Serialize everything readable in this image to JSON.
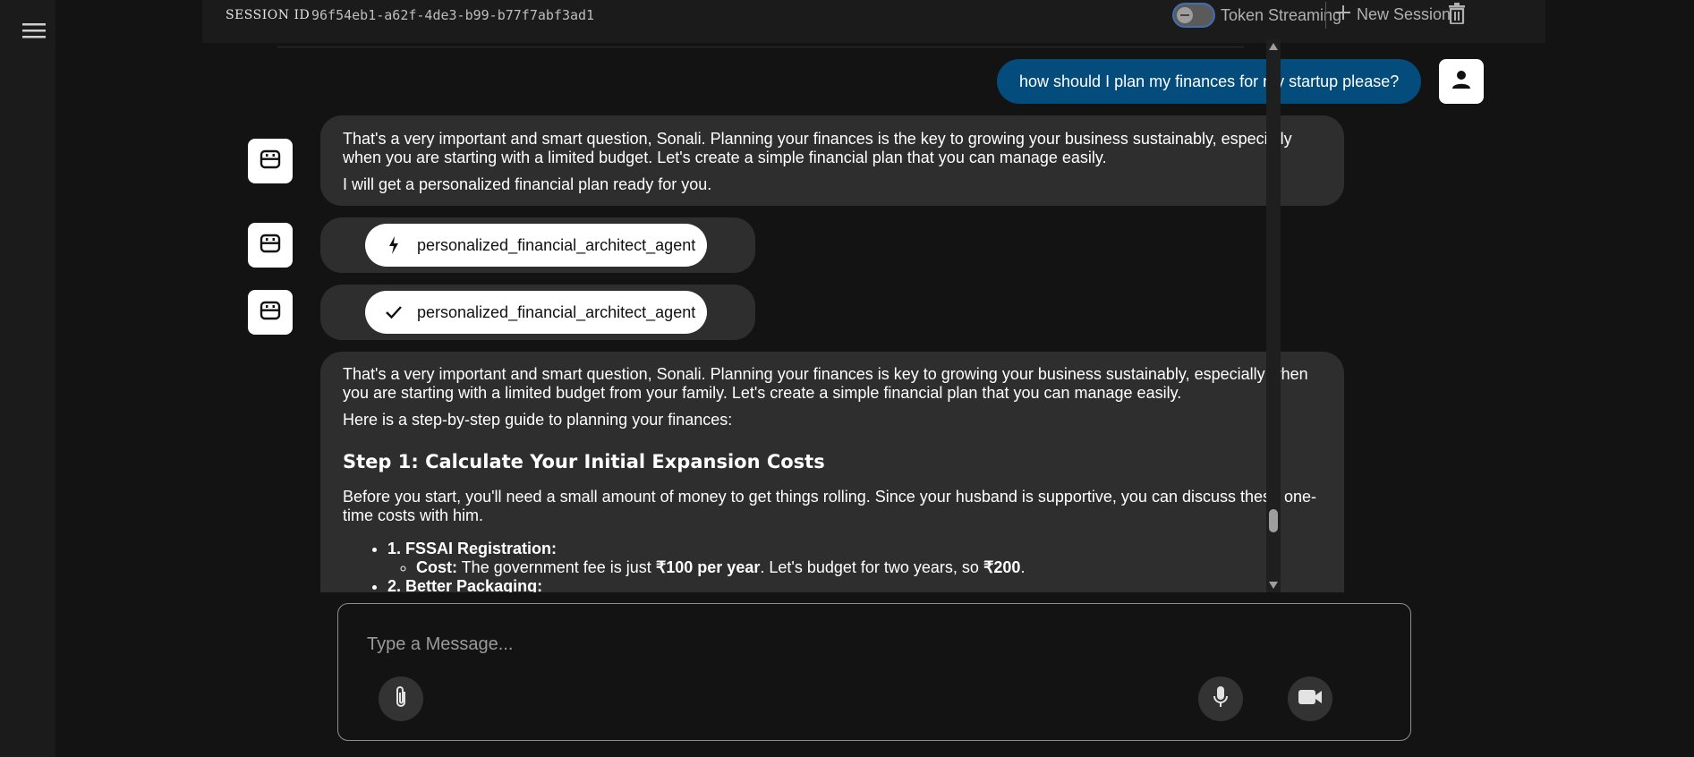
{
  "sidebar": {
    "menu_icon": "hamburger-menu-icon"
  },
  "header": {
    "session_label": "SESSION ID",
    "session_id": "96f54eb1-a62f-4de3-b99-b77f7abf3ad1",
    "token_streaming_label": "Token Streaming",
    "token_streaming_enabled": false,
    "new_session_label": "New Session",
    "new_session_icon": "plus-icon",
    "delete_icon": "trash-icon"
  },
  "messages": {
    "user_question": "how should I plan my finances for my startup please?",
    "bot_reply_1": {
      "line_1": "That's a very important and smart question, Sonali. Planning your finances is the key to growing your business sustainably, especially when you are starting with a limited budget. Let's create a simple financial plan that you can manage easily.",
      "line_2": "I will get a personalized financial plan ready for you."
    },
    "function_call": {
      "icon": "bolt-icon",
      "name": "personalized_financial_architect_agent"
    },
    "function_response": {
      "icon": "check-icon",
      "name": "personalized_financial_architect_agent"
    },
    "bot_reply_2": {
      "intro": "That's a very important and smart question, Sonali. Planning your finances is key to growing your business sustainably, especially when you are starting with a limited budget from your family. Let's create a simple financial plan that you can manage easily.",
      "guide_line": "Here is a step-by-step guide to planning your finances:",
      "step1_heading": "Step 1: Calculate Your Initial Expansion Costs",
      "step1_text": "Before you start, you'll need a small amount of money to get things rolling. Since your husband is supportive, you can discuss these one-time costs with him.",
      "item1_title": "1. FSSAI Registration:",
      "item1_cost_label": "Cost:",
      "item1_cost_text_a": "The government fee is just",
      "item1_cost_bold_a": "₹100 per year",
      "item1_cost_text_b": ". Let's budget for two years, so",
      "item1_cost_bold_b": "₹200",
      "item1_cost_text_c": ".",
      "item2_title": "2. Better Packaging:"
    }
  },
  "composer": {
    "placeholder": "Type a Message...",
    "attach_icon": "paperclip-icon",
    "mic_icon": "microphone-icon",
    "video_icon": "video-camera-icon"
  },
  "colors": {
    "background": "#131313",
    "user_bubble": "#044c7c",
    "bot_bubble": "#2e2e2e",
    "toggle_border": "#3e6fb3"
  }
}
